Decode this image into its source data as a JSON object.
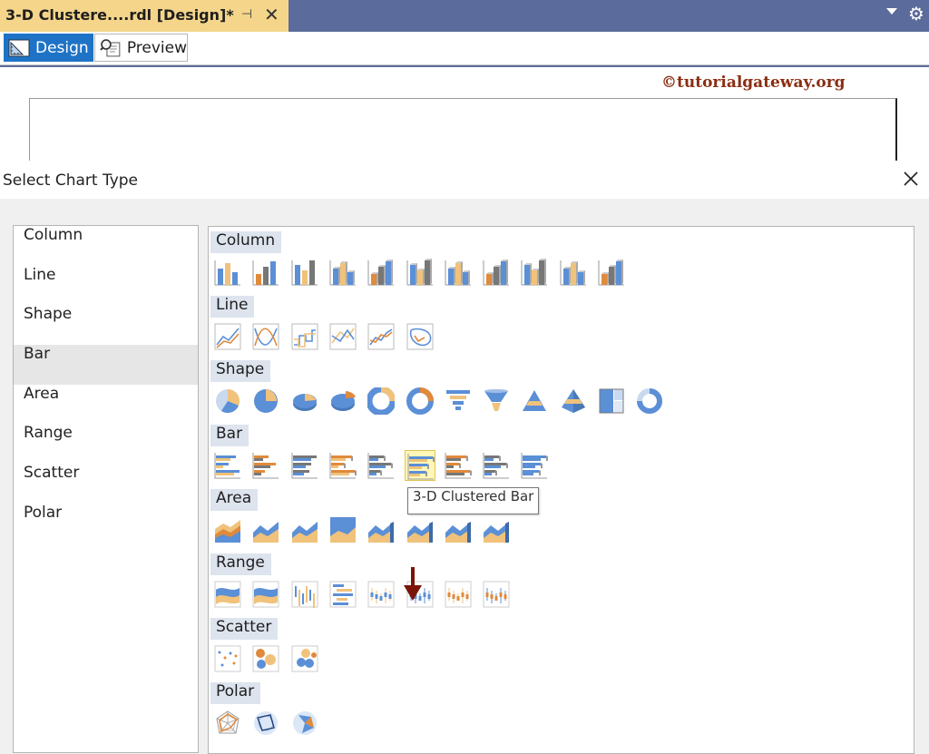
{
  "document_tab": {
    "title": "3-D Clustere....rdl [Design]*",
    "pin_icon": "pin-icon",
    "close_icon": "close-icon"
  },
  "tabbar_actions": {
    "dropdown_icon": "dropdown-icon",
    "settings_icon": "gear-icon"
  },
  "view_tabs": [
    {
      "label": "Design",
      "icon": "design-ruler-icon",
      "active": true
    },
    {
      "label": "Preview",
      "icon": "preview-magnifier-icon",
      "active": false
    }
  ],
  "watermark": "©tutorialgateway.org",
  "dialog": {
    "title": "Select Chart Type",
    "close_icon": "close-icon",
    "categories": [
      "Column",
      "Line",
      "Shape",
      "Bar",
      "Area",
      "Range",
      "Scatter",
      "Polar"
    ],
    "selected_category": "Bar",
    "gallery_groups": [
      {
        "label": "Column",
        "count": 11
      },
      {
        "label": "Line",
        "count": 6
      },
      {
        "label": "Shape",
        "count": 12
      },
      {
        "label": "Bar",
        "count": 9
      },
      {
        "label": "Area",
        "count": 8
      },
      {
        "label": "Range",
        "count": 8
      },
      {
        "label": "Scatter",
        "count": 3
      },
      {
        "label": "Polar",
        "count": 3
      }
    ],
    "highlighted_chart": "3-D Clustered Bar",
    "tooltip": "3-D Clustered Bar"
  },
  "colors": {
    "blue": "#5b8fd6",
    "orange": "#e08a3c",
    "tan": "#f0c27b",
    "gray": "#777777",
    "tab_active": "#f4d58a",
    "design_tab": "#1e73c6",
    "watermark": "#8b2e12",
    "arrow": "#7a1408"
  }
}
